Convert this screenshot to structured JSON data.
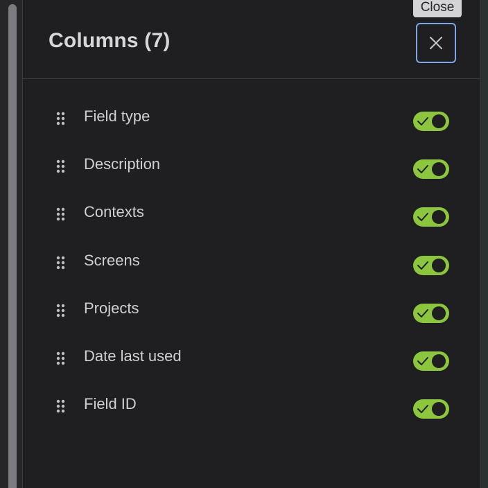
{
  "tooltip": {
    "text": "Close"
  },
  "panel": {
    "title": "Columns (7)",
    "close_icon": "close-icon"
  },
  "columns": [
    {
      "label": "Field type",
      "enabled": true
    },
    {
      "label": "Description",
      "enabled": true
    },
    {
      "label": "Contexts",
      "enabled": true
    },
    {
      "label": "Screens",
      "enabled": true
    },
    {
      "label": "Projects",
      "enabled": true
    },
    {
      "label": "Date last used",
      "enabled": true
    },
    {
      "label": "Field ID",
      "enabled": true
    }
  ],
  "icons": {
    "drag_handle": "drag-handle-icon",
    "toggle_check": "check-icon"
  },
  "colors": {
    "toggle_on": "#8cc63f",
    "focus_ring": "#7fa6e6",
    "panel_bg": "#1f1f21"
  }
}
